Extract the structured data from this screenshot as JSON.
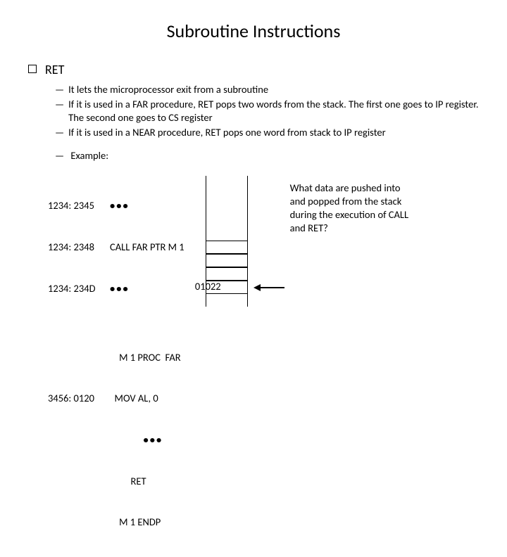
{
  "title": "Subroutine Instructions",
  "section": {
    "heading": "RET"
  },
  "bullets": [
    "It lets the microprocessor exit from a subroutine",
    "If it is used in a FAR procedure, RET pops two words from the stack. The first one goes to IP register. The second one goes to CS register",
    "If it is used in a NEAR procedure, RET pops one word from stack to IP register"
  ],
  "example_label": "Example:",
  "code": {
    "rows": [
      {
        "addr": "1234: 2345",
        "instr": "•••",
        "dots": true
      },
      {
        "addr": "1234: 2348",
        "instr": "CALL FAR PTR M 1"
      },
      {
        "addr": "1234: 234D",
        "instr": "•••",
        "dots": true
      },
      {
        "addr": "",
        "instr": ""
      },
      {
        "addr": "",
        "instr": "    M 1 PROC  FAR"
      },
      {
        "addr": "3456: 0120",
        "instr": "  MOV AL, 0"
      },
      {
        "addr": "",
        "instr": "         •••",
        "dots": true
      },
      {
        "addr": "",
        "instr": "         RET"
      },
      {
        "addr": "",
        "instr": "    M 1 ENDP"
      }
    ]
  },
  "stack": {
    "label": "01022"
  },
  "question": "What data are pushed into and popped from the stack during the execution of CALL and RET?",
  "dash": "—"
}
